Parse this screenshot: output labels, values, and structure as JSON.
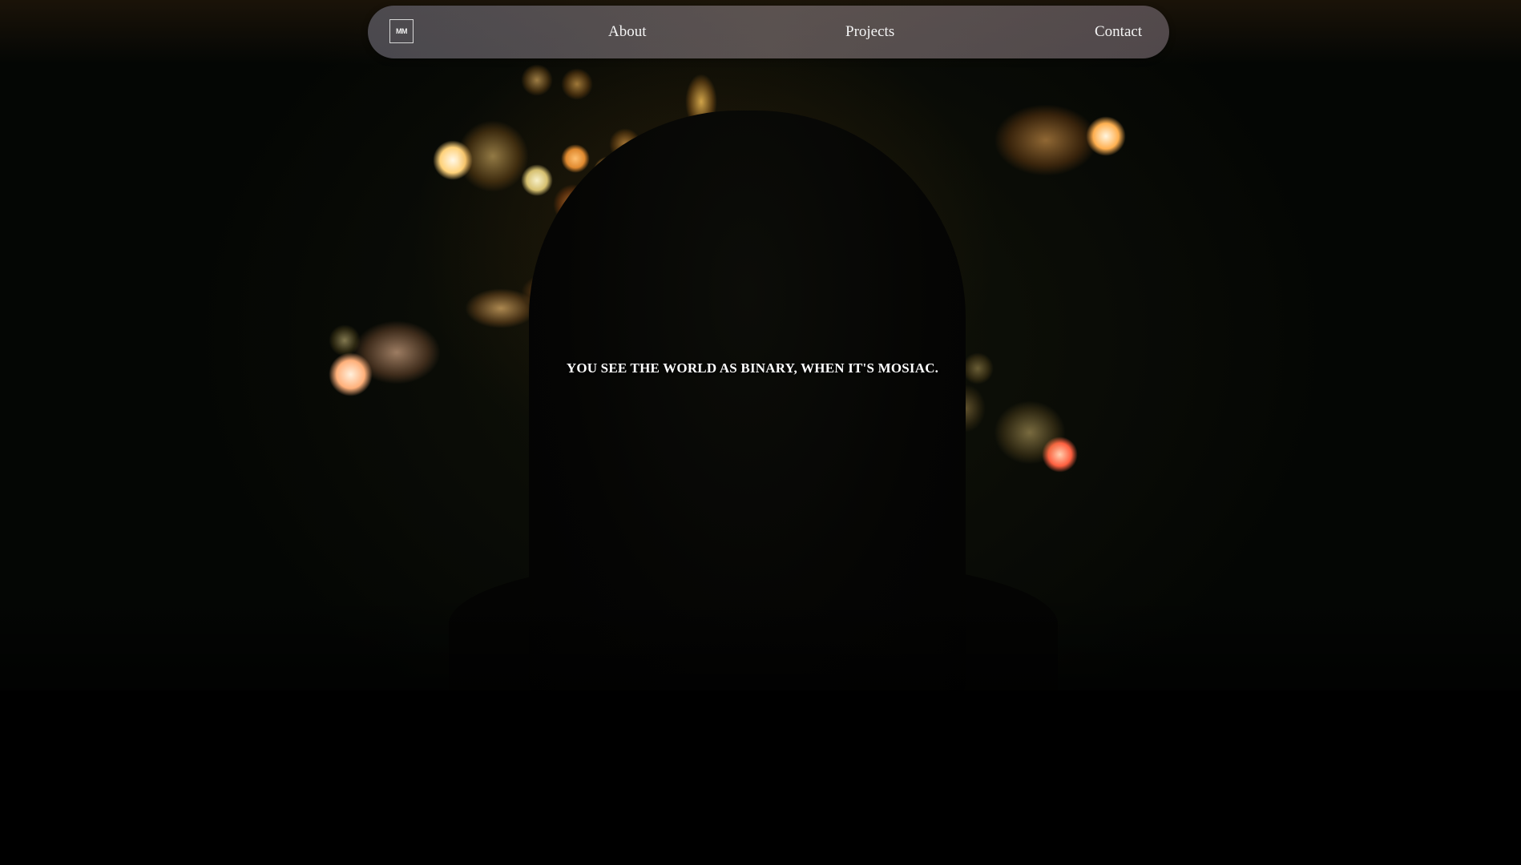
{
  "nav": {
    "logo_text": "MM",
    "links": [
      {
        "label": "About"
      },
      {
        "label": "Projects"
      },
      {
        "label": "Contact"
      }
    ]
  },
  "hero": {
    "tagline": "YOU SEE THE WORLD AS BINARY, WHEN IT'S MOSIAC."
  },
  "colors": {
    "background": "#000000",
    "nav_background": "#5a5660",
    "text": "#ffffff"
  }
}
